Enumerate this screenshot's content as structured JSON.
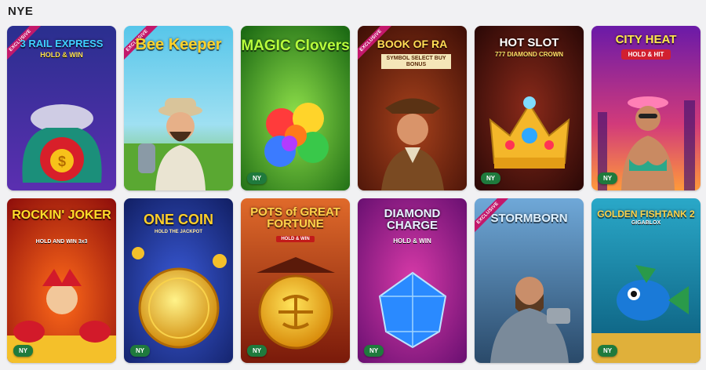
{
  "section": {
    "title": "NYE"
  },
  "badges": {
    "ny": "NY",
    "exclusive": "EXCLUSIVE"
  },
  "games": [
    {
      "title": "3 RAIL EXPRESS",
      "subtitle": "HOLD & WIN",
      "exclusive": true,
      "ny": false
    },
    {
      "title": "Bee Keeper",
      "subtitle": "",
      "exclusive": true,
      "ny": false
    },
    {
      "title": "MAGIC Clovers",
      "subtitle": "",
      "exclusive": false,
      "ny": true
    },
    {
      "title": "BOOK OF RA",
      "subtitle": "SYMBOL SELECT BUY BONUS",
      "exclusive": true,
      "ny": false
    },
    {
      "title": "HOT SLOT",
      "subtitle": "777 DIAMOND CROWN",
      "exclusive": false,
      "ny": true
    },
    {
      "title": "CITY HEAT",
      "subtitle": "HOLD & HIT",
      "exclusive": false,
      "ny": true
    },
    {
      "title": "ROCKIN' JOKER",
      "subtitle": "HOLD AND WIN 3x3",
      "exclusive": false,
      "ny": true
    },
    {
      "title": "ONE COIN",
      "subtitle": "HOLD THE JACKPOT",
      "exclusive": false,
      "ny": true
    },
    {
      "title": "POTS of GREAT FORTUNE",
      "subtitle": "HOLD & WIN",
      "exclusive": false,
      "ny": true
    },
    {
      "title": "DIAMOND CHARGE",
      "subtitle": "HOLD & WIN",
      "exclusive": false,
      "ny": true
    },
    {
      "title": "STORMBORN",
      "subtitle": "",
      "exclusive": true,
      "ny": false
    },
    {
      "title": "GOLDEN FISHTANK 2",
      "subtitle": "GIGABLOX",
      "exclusive": false,
      "ny": true
    }
  ]
}
